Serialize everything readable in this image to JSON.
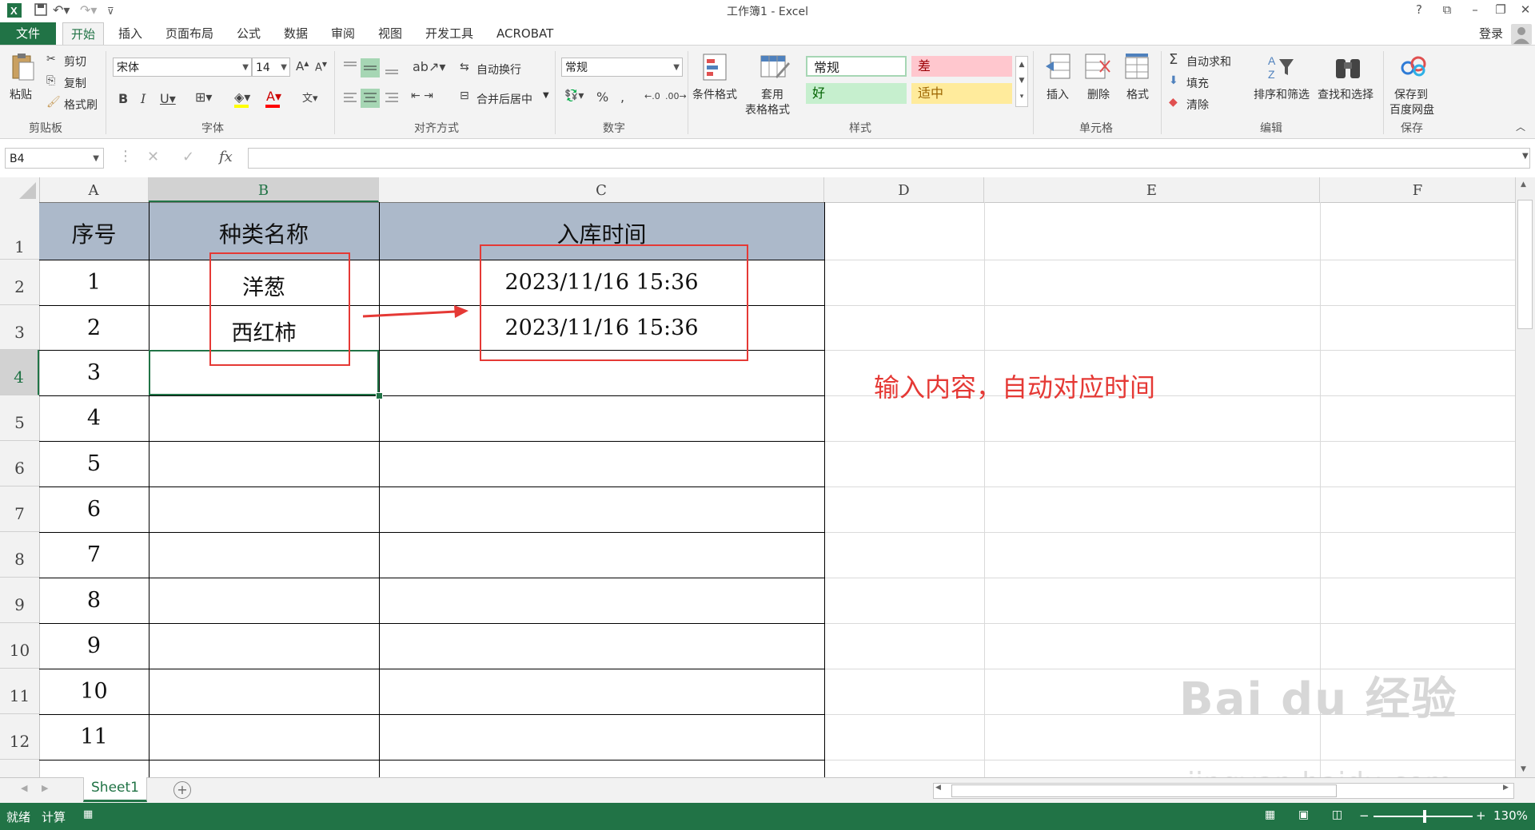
{
  "window": {
    "title": "工作簿1 - Excel",
    "help": "?",
    "login": "登录"
  },
  "tabs": {
    "file": "文件",
    "items": [
      "开始",
      "插入",
      "页面布局",
      "公式",
      "数据",
      "审阅",
      "视图",
      "开发工具",
      "ACROBAT"
    ]
  },
  "ribbon": {
    "clipboard": {
      "paste": "粘贴",
      "cut": "剪切",
      "copy": "复制",
      "format_painter": "格式刷",
      "group": "剪贴板"
    },
    "font": {
      "name": "宋体",
      "size": "14",
      "group": "字体"
    },
    "alignment": {
      "wrap": "自动换行",
      "merge": "合并后居中",
      "group": "对齐方式"
    },
    "number": {
      "format": "常规",
      "group": "数字"
    },
    "styles": {
      "conditional": "条件格式",
      "table_line1": "套用",
      "table_line2": "表格格式",
      "normal": "常规",
      "bad": "差",
      "good": "好",
      "neutral": "适中",
      "group": "样式"
    },
    "cells": {
      "insert": "插入",
      "delete": "删除",
      "format": "格式",
      "group": "单元格"
    },
    "editing": {
      "autosum": "自动求和",
      "fill": "填充",
      "clear": "清除",
      "sort": "排序和筛选",
      "find": "查找和选择",
      "group": "编辑"
    },
    "save": {
      "line1": "保存到",
      "line2": "百度网盘",
      "group": "保存"
    }
  },
  "formula_bar": {
    "name_box": "B4",
    "fx": "fx",
    "value": ""
  },
  "columns": [
    "A",
    "B",
    "C",
    "D",
    "E",
    "F"
  ],
  "rows": [
    "1",
    "2",
    "3",
    "4",
    "5",
    "6",
    "7",
    "8",
    "9",
    "10",
    "11",
    "12"
  ],
  "table": {
    "headers": {
      "seq": "序号",
      "kind": "种类名称",
      "time": "入库时间"
    },
    "seq": [
      "1",
      "2",
      "3",
      "4",
      "5",
      "6",
      "7",
      "8",
      "9",
      "10",
      "11"
    ],
    "kind": [
      "洋葱",
      "西红柿"
    ],
    "time": [
      "2023/11/16 15:36",
      "2023/11/16 15:36"
    ]
  },
  "annotation": "输入内容，自动对应时间",
  "sheet": {
    "tab": "Sheet1",
    "add": "+"
  },
  "status": {
    "ready": "就绪",
    "calc": "计算",
    "zoom": "130%"
  },
  "watermark": {
    "brand": "Bai du 经验",
    "url": "jingyan.baidu.com"
  },
  "colors": {
    "excel_green": "#217346",
    "header_fill": "#acb9ca",
    "annotation_red": "#e53935"
  }
}
